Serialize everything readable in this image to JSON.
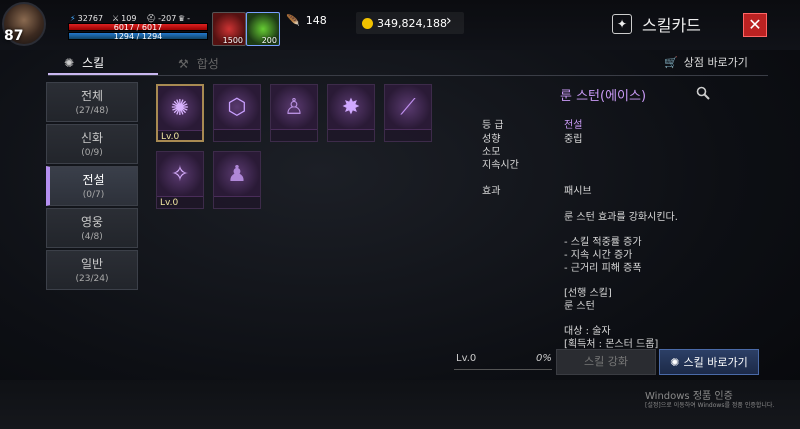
{
  "player": {
    "level": "87",
    "power": "32767",
    "stat1": "109",
    "stat2": "-207",
    "stat3": "-",
    "hp": "6017 / 6017",
    "mp": "1294 / 1294"
  },
  "items": [
    {
      "name": "potion",
      "count": "1500"
    },
    {
      "name": "herb",
      "count": "200"
    }
  ],
  "currency": {
    "feather": "148",
    "gold": "349,824,188"
  },
  "window": {
    "title": "스킬카드",
    "close": "✕"
  },
  "tabs": [
    {
      "label": "스킬"
    },
    {
      "label": "합성"
    }
  ],
  "shortcut_label": "상점 바로가기",
  "categories": [
    {
      "label": "전체",
      "count": "(27/48)"
    },
    {
      "label": "신화",
      "count": "(0/9)"
    },
    {
      "label": "전설",
      "count": "(0/7)"
    },
    {
      "label": "영웅",
      "count": "(4/8)"
    },
    {
      "label": "일반",
      "count": "(23/24)"
    }
  ],
  "skills": [
    {
      "lv": "Lv.0"
    },
    {
      "lv": ""
    },
    {
      "lv": ""
    },
    {
      "lv": ""
    },
    {
      "lv": ""
    },
    {
      "lv": "Lv.0"
    },
    {
      "lv": ""
    }
  ],
  "detail": {
    "title": "룬 스턴(에이스)",
    "grade_label": "등 급",
    "grade_value": "전설",
    "trait_label": "성향",
    "trait_value": "중립",
    "cost_label": "소모",
    "duration_label": "지속시간",
    "effect_label": "효과",
    "effect_value": "패시브",
    "desc": "룬 스턴 효과를 강화시킨다.",
    "bullets": [
      "- 스킬 적중률 증가",
      "- 지속 시간 증가",
      "- 근거리 피해 증폭"
    ],
    "prereq_label": "[선행 스킬]",
    "prereq_value": "룬 스턴",
    "target": "대상 : 술자",
    "source": "[획득처 : 몬스터 드롭]"
  },
  "progress": {
    "level": "Lv.0",
    "percent": "0%"
  },
  "buttons": {
    "enhance": "스킬 강화",
    "goto": "스킬 바로가기"
  },
  "watermark": {
    "line1": "Windows 정품 인증",
    "line2": "[설정]으로 이동하여 Windows를 정품 인증합니다."
  }
}
